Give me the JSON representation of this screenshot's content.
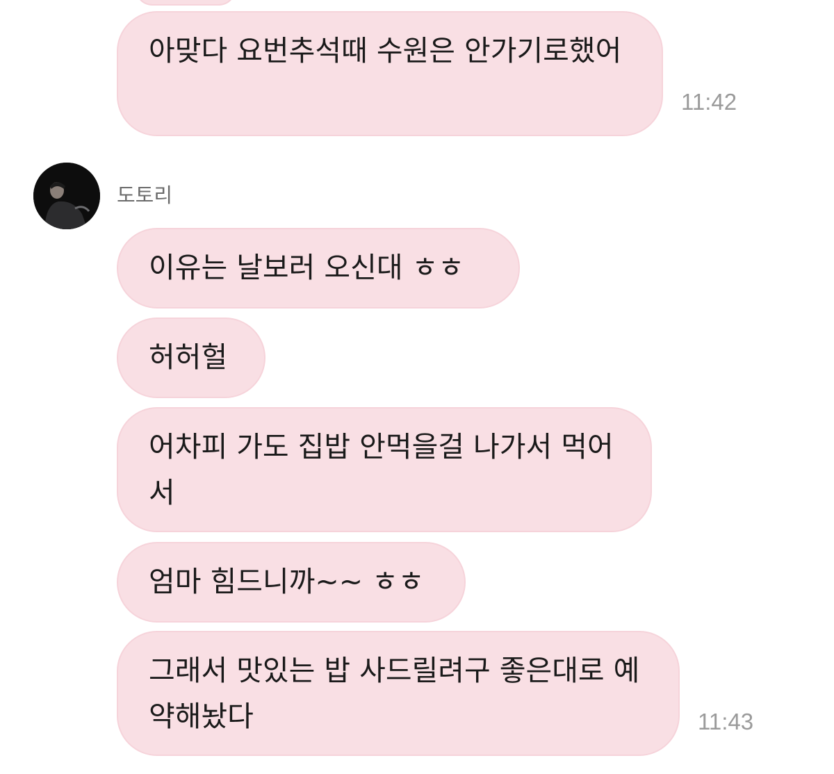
{
  "chat": {
    "messages": [
      {
        "text": "아맞다 요번추석때 수원은 안가기로했어",
        "time": "11:42"
      },
      {
        "text": "이유는 날보러 오신대 ㅎㅎ"
      },
      {
        "text": "허허헐"
      },
      {
        "text": "어차피 가도 집밥 안먹을걸 나가서 먹어서"
      },
      {
        "text": "엄마 힘드니까~~ ㅎㅎ"
      },
      {
        "text": "그래서 맛있는 밥 사드릴려구 좋은대로 예약해놨다",
        "time": "11:43"
      }
    ],
    "sender": {
      "name": "도토리",
      "avatar_icon": "profile-photo-avatar"
    }
  },
  "colors": {
    "bubble_bg": "#f9dfe4",
    "bubble_border": "#f6d3da",
    "timestamp": "#9a9a9a"
  }
}
